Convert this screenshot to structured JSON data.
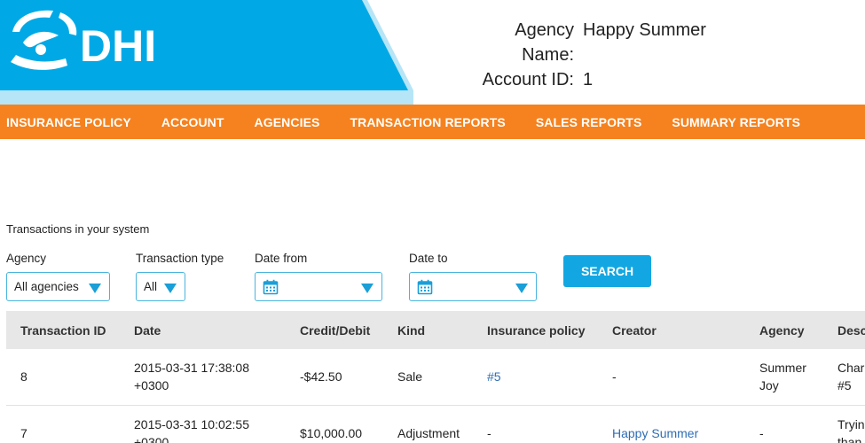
{
  "brand": {
    "logo_text": "DHI",
    "primary_color": "#00a9e6",
    "accent_color": "#f5821f"
  },
  "agency_info": {
    "name_label": "Agency Name:",
    "name_value": "Happy Summer",
    "id_label": "Account ID:",
    "id_value": "1"
  },
  "nav": {
    "items": [
      {
        "label": "INSURANCE POLICY"
      },
      {
        "label": "ACCOUNT"
      },
      {
        "label": "AGENCIES"
      },
      {
        "label": "TRANSACTION REPORTS"
      },
      {
        "label": "SALES REPORTS"
      },
      {
        "label": "SUMMARY REPORTS"
      }
    ]
  },
  "section_title": "Transactions in your system",
  "filters": {
    "agency": {
      "label": "Agency",
      "value": "All agencies"
    },
    "type": {
      "label": "Transaction type",
      "value": "All"
    },
    "date_from": {
      "label": "Date from",
      "value": ""
    },
    "date_to": {
      "label": "Date to",
      "value": ""
    },
    "search_label": "SEARCH"
  },
  "table": {
    "headers": [
      "Transaction ID",
      "Date",
      "Credit/Debit",
      "Kind",
      "Insurance policy",
      "Creator",
      "Agency",
      "Desc"
    ],
    "rows": [
      {
        "id": "8",
        "date_line1": "2015-03-31 17:38:08",
        "date_line2": "+0300",
        "amount": "-$42.50",
        "kind": "Sale",
        "policy": "#5",
        "creator": "-",
        "agency_line1": "Summer",
        "agency_line2": "Joy",
        "desc_line1": "Char",
        "desc_line2": "#5"
      },
      {
        "id": "7",
        "date_line1": "2015-03-31 10:02:55",
        "date_line2": "+0300",
        "amount": "$10,000.00",
        "kind": "Adjustment",
        "policy": "-",
        "creator": "Happy Summer",
        "agency_line1": "-",
        "agency_line2": "",
        "desc_line1": "Tryin",
        "desc_line2": "than"
      }
    ]
  }
}
